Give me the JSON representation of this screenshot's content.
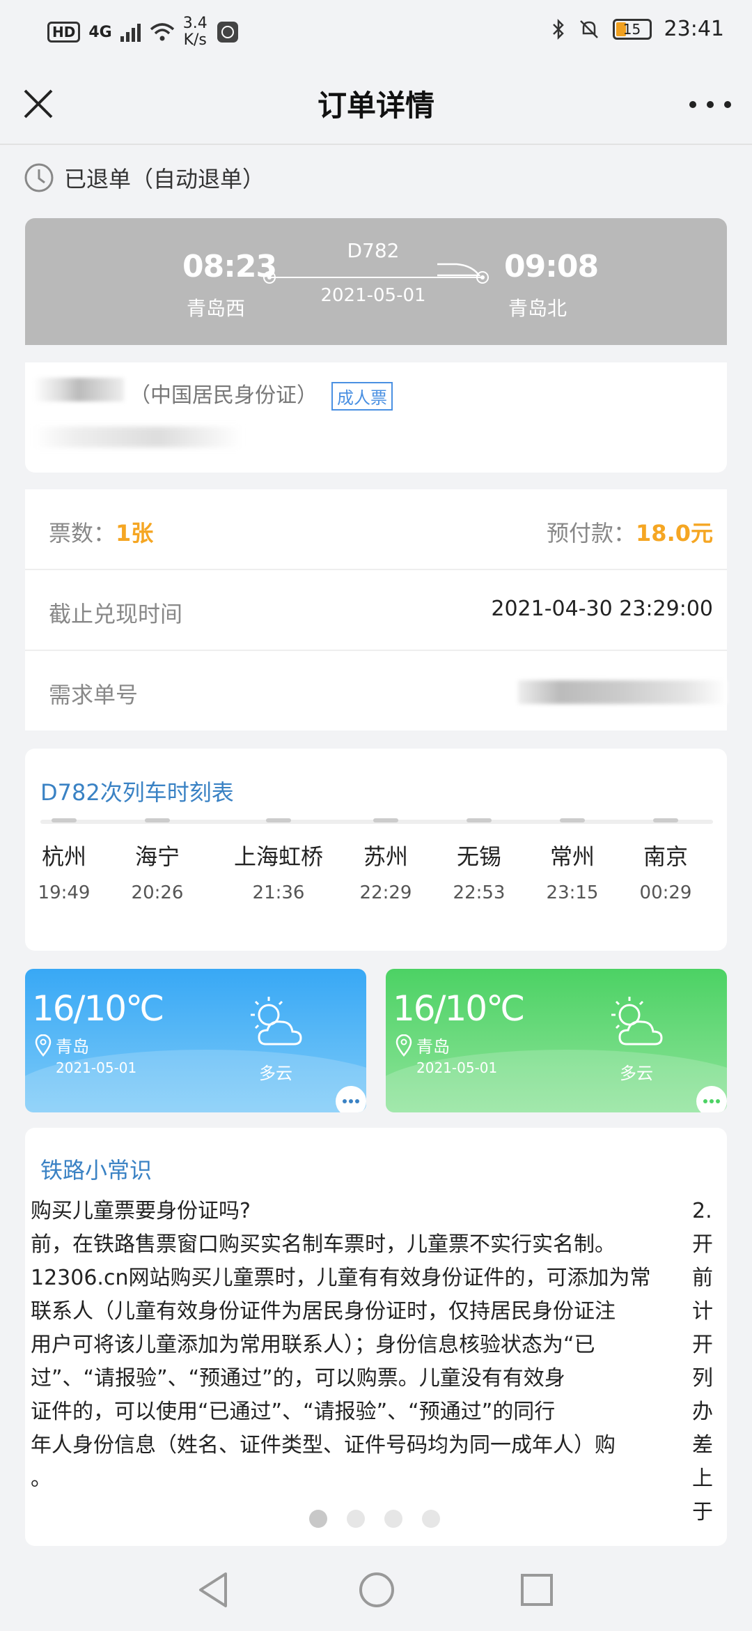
{
  "status_bar": {
    "hd": "HD",
    "network": "4G",
    "speed_value": "3.4",
    "speed_unit": "K/s",
    "battery": "15",
    "time": "23:41"
  },
  "header": {
    "title": "订单详情"
  },
  "order": {
    "status": "已退单（自动退单）"
  },
  "train": {
    "depart_time": "08:23",
    "depart_station": "青岛西",
    "number": "D782",
    "date": "2021-05-01",
    "arrive_time": "09:08",
    "arrive_station": "青岛北"
  },
  "passenger": {
    "id_type": "（中国居民身份证）",
    "ticket_type": "成人票"
  },
  "info": {
    "ticket_count_label": "票数：",
    "ticket_count": "1张",
    "prepay_label": "预付款：",
    "prepay": "18.0元",
    "deadline_label": "截止兑现时间",
    "deadline": "2021-04-30 23:29:00",
    "order_no_label": "需求单号"
  },
  "schedule": {
    "title": "D782次列车时刻表",
    "stops": [
      {
        "name": "杭州",
        "time": "19:49"
      },
      {
        "name": "海宁",
        "time": "20:26"
      },
      {
        "name": "上海虹桥",
        "time": "21:36"
      },
      {
        "name": "苏州",
        "time": "22:29"
      },
      {
        "name": "无锡",
        "time": "22:53"
      },
      {
        "name": "常州",
        "time": "23:15"
      },
      {
        "name": "南京",
        "time": "00:29"
      }
    ]
  },
  "weather": [
    {
      "temp": "16/10℃",
      "city": "青岛",
      "date": "2021-05-01",
      "desc": "多云",
      "color": "#38a8f5"
    },
    {
      "temp": "16/10℃",
      "city": "青岛",
      "date": "2021-05-01",
      "desc": "多云",
      "color": "#4cd264"
    }
  ],
  "tips": {
    "title": "铁路小常识",
    "body": "购买儿童票要身份证吗?\n前，在铁路售票窗口购买实名制车票时，儿童票不实行实名制。\n12306.cn网站购买儿童票时，儿童有有效身份证件的，可添加为常\n联系人（儿童有效身份证件为居民身份证时，仅持居民身份证注\n用户可将该儿童添加为常用联系人）；身份信息核验状态为“已\n过”、“请报验”、“预通过”的，可以购票。儿童没有有效身\n证件的，可以使用“已通过”、“请报验”、“预通过”的同行\n年人身份信息（姓名、证件类型、证件号码均为同一成年人）购\n。",
    "side": "2.\n开\n前\n计\n开\n列\n办\n差\n上\n于"
  }
}
